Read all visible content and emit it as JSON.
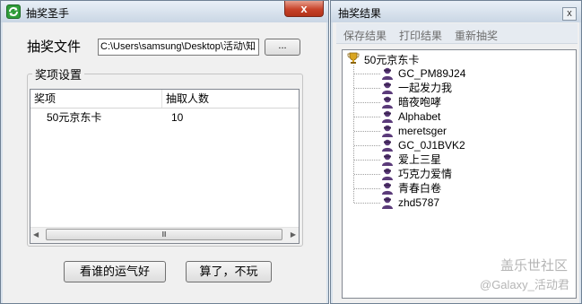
{
  "main_window": {
    "title": "抽奖圣手",
    "close_symbol": "x",
    "file_label": "抽奖文件",
    "file_path": "C:\\Users\\samsung\\Desktop\\活动\\知",
    "browse_label": "...",
    "group_title": "奖项设置",
    "columns": [
      "奖项",
      "抽取人数"
    ],
    "rows": [
      {
        "prize": "50元京东卡",
        "count": "10"
      }
    ],
    "scroll_left": "◀",
    "scroll_right": "▶",
    "scroll_grip": "Ⅲ",
    "draw_button": "看谁的运气好",
    "cancel_button": "算了，不玩"
  },
  "result_window": {
    "title": "抽奖结果",
    "close_symbol": "x",
    "menu": [
      "保存结果",
      "打印结果",
      "重新抽奖"
    ],
    "root": "50元京东卡",
    "winners": [
      "GC_PM89J24",
      "一起发力我",
      "暗夜咆哮",
      "Alphabet",
      "meretsger",
      "GC_0J1BVK2",
      "爱上三星",
      "巧克力爱情",
      "青春白卷",
      "zhd5787"
    ]
  },
  "watermark": {
    "line1": "盖乐世社区",
    "line2": "@Galaxy_活动君"
  },
  "colors": {
    "title_bar": "#c9d6e4",
    "close_button": "#c7432a",
    "app_icon": "#2f9d3a",
    "trophy": "#d9a520",
    "user_icon": "#5b3b7a"
  }
}
